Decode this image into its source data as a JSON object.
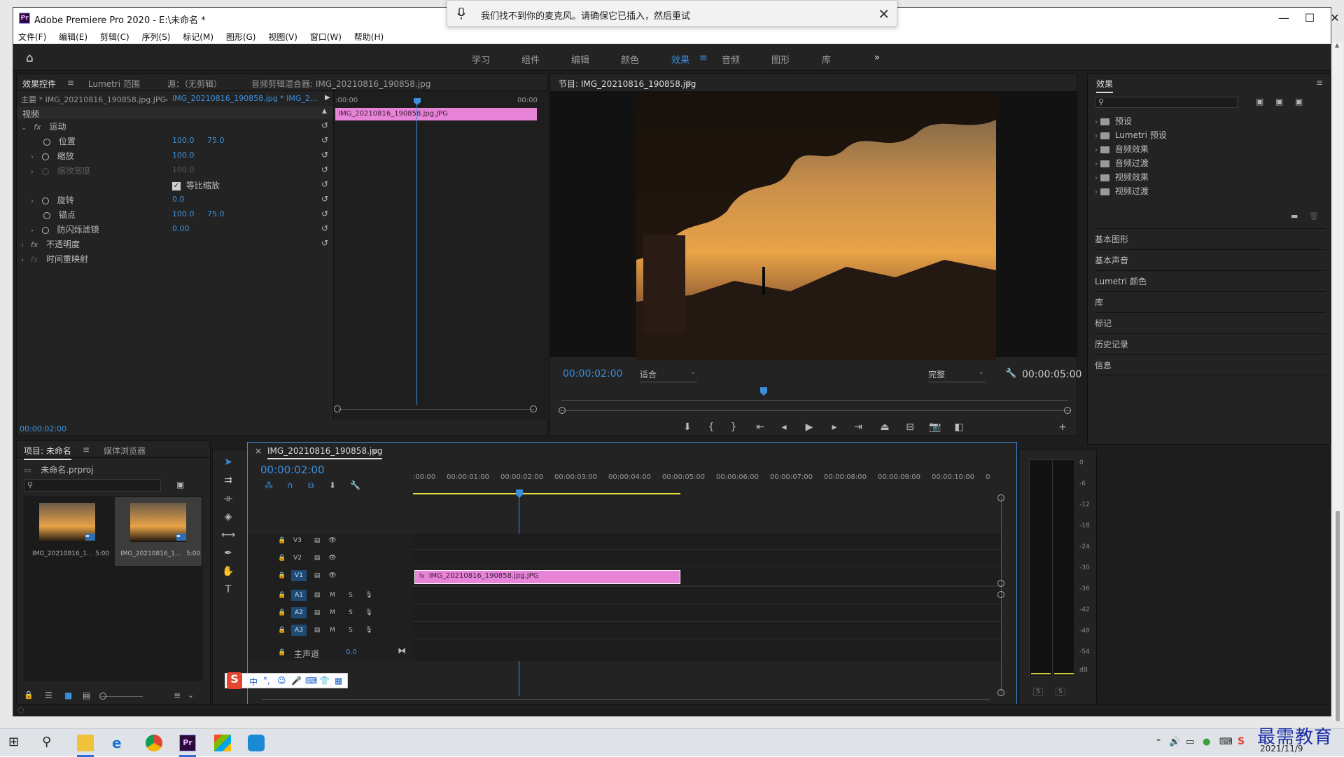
{
  "window": {
    "title": "Adobe Premiere Pro 2020 - E:\\未命名 *",
    "logo": "Pr",
    "controls": [
      "minimize-icon",
      "maximize-icon",
      "close-icon"
    ]
  },
  "menu": [
    "文件(F)",
    "编辑(E)",
    "剪辑(C)",
    "序列(S)",
    "标记(M)",
    "图形(G)",
    "视图(V)",
    "窗口(W)",
    "帮助(H)"
  ],
  "workspaces": {
    "items": [
      "学习",
      "组件",
      "编辑",
      "颜色",
      "效果",
      "音频",
      "图形",
      "库"
    ],
    "active": "效果",
    "more": "»"
  },
  "notification": {
    "message": "我们找不到你的麦克风。请确保它已插入，然后重试"
  },
  "effect_controls": {
    "tabs": [
      "效果控件",
      "Lumetri 范围",
      "源：（无剪辑）",
      "音频剪辑混合器: IMG_20210816_190858.jpg"
    ],
    "master_label": "主要 * IMG_20210816_190858.jpg.JPG",
    "sequence_label": "IMG_20210816_190858.jpg * IMG_2...",
    "section_video": "视频",
    "timeline_start": ":00:00",
    "timeline_end": "00:00",
    "clip_name": "IMG_20210816_190858.jpg.JPG",
    "motion": "运动",
    "position": {
      "label": "位置",
      "x": "100.0",
      "y": "75.0"
    },
    "scale": {
      "label": "缩放",
      "value": "100.0"
    },
    "scale_width": {
      "label": "缩放宽度",
      "value": "100.0"
    },
    "uniform": {
      "label": "等比缩放"
    },
    "rotation": {
      "label": "旋转",
      "value": "0.0"
    },
    "anchor": {
      "label": "锚点",
      "x": "100.0",
      "y": "75.0"
    },
    "antiflicker": {
      "label": "防闪烁滤镜",
      "value": "0.00"
    },
    "opacity": "不透明度",
    "time_remap": "时间重映射",
    "timecode": "00:00:02:00"
  },
  "program_monitor": {
    "title": "节目: IMG_20210816_190858.jpg",
    "timecode": "00:00:02:00",
    "fit": "适合",
    "quality": "完整",
    "duration": "00:00:05:00"
  },
  "effects_panel": {
    "title": "效果",
    "tree": [
      "预设",
      "Lumetri 预设",
      "音频效果",
      "音频过渡",
      "视频效果",
      "视频过渡"
    ],
    "panels": [
      "基本图形",
      "基本声音",
      "Lumetri 颜色",
      "库",
      "标记",
      "历史记录",
      "信息"
    ]
  },
  "project": {
    "tabs": [
      "项目: 未命名",
      "媒体浏览器"
    ],
    "file": "未命名.prproj",
    "items": [
      {
        "name": "IMG_20210816_1...",
        "duration": "5:00"
      },
      {
        "name": "IMG_20210816_1...",
        "duration": "5:00"
      }
    ]
  },
  "timeline": {
    "tab": "IMG_20210816_190858.jpg",
    "timecode": "00:00:02:00",
    "ruler": [
      ":00:00",
      "00:00:01:00",
      "00:00:02:00",
      "00:00:03:00",
      "00:00:04:00",
      "00:00:05:00",
      "00:00:06:00",
      "00:00:07:00",
      "00:00:08:00",
      "00:00:09:00",
      "00:00:10:00",
      "0"
    ],
    "video_tracks": [
      "V3",
      "V2",
      "V1"
    ],
    "audio_tracks": [
      "A1",
      "A2",
      "A3"
    ],
    "mute": "M",
    "solo": "S",
    "master": {
      "label": "主声道",
      "value": "0.0"
    },
    "clip": "IMG_20210816_190858.jpg.JPG",
    "fx": "fx"
  },
  "audio_meter": {
    "scale": [
      "0",
      "-6",
      "-12",
      "-18",
      "-24",
      "-30",
      "-36",
      "-42",
      "-48",
      "-54",
      "dB"
    ],
    "solo": [
      "S",
      "S"
    ]
  },
  "ime": {
    "items": [
      "中",
      "°,"
    ]
  },
  "taskbar": {
    "date": "2021/11/9",
    "icons": [
      "windows-icon",
      "search-icon",
      "file-explorer-icon",
      "edge-icon",
      "chrome-icon",
      "premiere-icon",
      "photos-icon",
      "phone-icon"
    ]
  },
  "watermark": "最需教育",
  "colors": {
    "accent": "#3c8fdd",
    "clip": "#e884d8",
    "panel": "#232323"
  }
}
